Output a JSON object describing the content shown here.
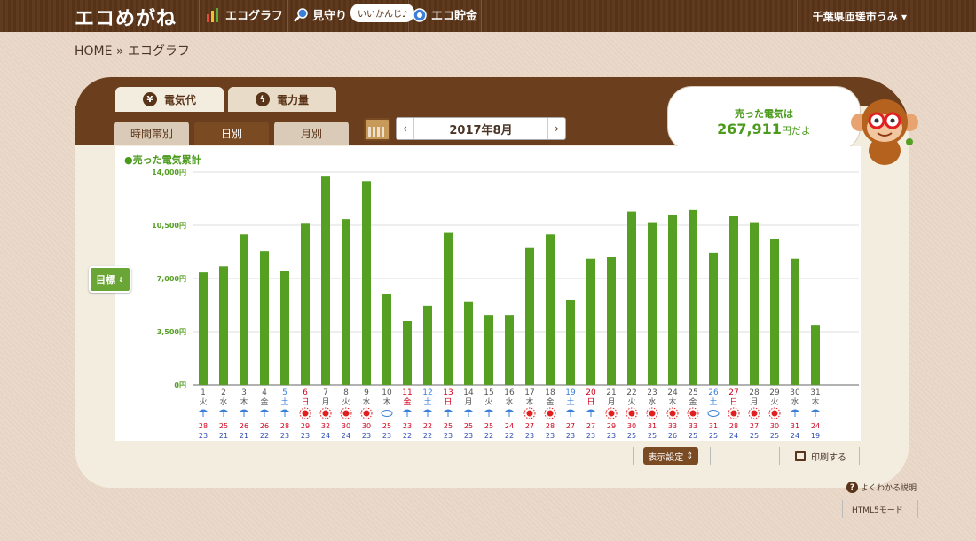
{
  "header": {
    "logo": "エコめがね",
    "nav": [
      {
        "label": "エコグラフ",
        "icon": "bar-chart-icon"
      },
      {
        "label": "見守り",
        "icon": "magnifier-icon"
      },
      {
        "label": "エコ貯金",
        "icon": "coin-icon"
      }
    ],
    "bubble": "いいかんじ♪",
    "user_location": "千葉県匝瑳市うみ",
    "user_dropdown_icon": "chevron-down-icon"
  },
  "breadcrumb": "HOME » エコグラフ",
  "tabs_primary": [
    {
      "label": "電気代",
      "icon": "yen-icon",
      "active": true
    },
    {
      "label": "電力量",
      "icon": "lightning-icon",
      "active": false
    }
  ],
  "tabs_secondary": [
    {
      "label": "時間帯別",
      "active": false
    },
    {
      "label": "日別",
      "active": true
    },
    {
      "label": "月別",
      "active": false
    }
  ],
  "month_selector": {
    "prev": "‹",
    "label": "2017年8月",
    "next": "›"
  },
  "balloon": {
    "line1": "売った電気は",
    "amount": "267,911",
    "suffix": "円だよ"
  },
  "chart_title": "●売った電気累計",
  "goal_button": "目標",
  "display_settings": "表示設定",
  "print_label": "印刷する",
  "help_label": "よくわかる説明",
  "html5_label": "HTML5モード",
  "colors": {
    "bar": "#55a023",
    "brown": "#5a3418",
    "sunday": "#d0021b",
    "saturday": "#3b7fd8",
    "high_temp": "#d0021b",
    "low_temp": "#2a4ab0"
  },
  "chart_data": {
    "type": "bar",
    "title": "売った電気累計",
    "yunit": "円",
    "ylim": [
      0,
      14000
    ],
    "yticks": [
      "0円",
      "3,500円",
      "7,000円",
      "10,500円",
      "14,000円"
    ],
    "days": [
      {
        "d": "1",
        "w": "火",
        "v": 7400,
        "wx": "rain",
        "hi": 28,
        "lo": 23,
        "c": "n"
      },
      {
        "d": "2",
        "w": "水",
        "v": 7800,
        "wx": "rain",
        "hi": 25,
        "lo": 21,
        "c": "n"
      },
      {
        "d": "3",
        "w": "木",
        "v": 9900,
        "wx": "rain",
        "hi": 26,
        "lo": 21,
        "c": "n"
      },
      {
        "d": "4",
        "w": "金",
        "v": 8800,
        "wx": "umbrella",
        "hi": 26,
        "lo": 22,
        "c": "n"
      },
      {
        "d": "5",
        "w": "土",
        "v": 7500,
        "wx": "rain",
        "hi": 28,
        "lo": 23,
        "c": "sat"
      },
      {
        "d": "6",
        "w": "日",
        "v": 10600,
        "wx": "sun",
        "hi": 29,
        "lo": 23,
        "c": "sun"
      },
      {
        "d": "7",
        "w": "月",
        "v": 13700,
        "wx": "sun",
        "hi": 32,
        "lo": 24,
        "c": "n"
      },
      {
        "d": "8",
        "w": "火",
        "v": 10900,
        "wx": "sun",
        "hi": 30,
        "lo": 24,
        "c": "n"
      },
      {
        "d": "9",
        "w": "水",
        "v": 13400,
        "wx": "sun",
        "hi": 30,
        "lo": 23,
        "c": "n"
      },
      {
        "d": "10",
        "w": "木",
        "v": 6000,
        "wx": "cloud",
        "hi": 25,
        "lo": 23,
        "c": "n"
      },
      {
        "d": "11",
        "w": "金",
        "v": 4200,
        "wx": "rain",
        "hi": 23,
        "lo": 22,
        "c": "sun"
      },
      {
        "d": "12",
        "w": "土",
        "v": 5200,
        "wx": "rain",
        "hi": 22,
        "lo": 22,
        "c": "sat"
      },
      {
        "d": "13",
        "w": "日",
        "v": 10000,
        "wx": "rain",
        "hi": 25,
        "lo": 23,
        "c": "sun"
      },
      {
        "d": "14",
        "w": "月",
        "v": 5500,
        "wx": "rain",
        "hi": 25,
        "lo": 23,
        "c": "n"
      },
      {
        "d": "15",
        "w": "火",
        "v": 4600,
        "wx": "rain",
        "hi": 25,
        "lo": 22,
        "c": "n"
      },
      {
        "d": "16",
        "w": "水",
        "v": 4600,
        "wx": "rain",
        "hi": 24,
        "lo": 22,
        "c": "n"
      },
      {
        "d": "17",
        "w": "木",
        "v": 9000,
        "wx": "sun",
        "hi": 27,
        "lo": 23,
        "c": "n"
      },
      {
        "d": "18",
        "w": "金",
        "v": 9900,
        "wx": "sun",
        "hi": 28,
        "lo": 23,
        "c": "n"
      },
      {
        "d": "19",
        "w": "土",
        "v": 5600,
        "wx": "rain",
        "hi": 27,
        "lo": 23,
        "c": "sat"
      },
      {
        "d": "20",
        "w": "日",
        "v": 8300,
        "wx": "rain",
        "hi": 27,
        "lo": 23,
        "c": "sun"
      },
      {
        "d": "21",
        "w": "月",
        "v": 8400,
        "wx": "sun",
        "hi": 29,
        "lo": 23,
        "c": "n"
      },
      {
        "d": "22",
        "w": "火",
        "v": 11400,
        "wx": "sun",
        "hi": 30,
        "lo": 25,
        "c": "n"
      },
      {
        "d": "23",
        "w": "水",
        "v": 10700,
        "wx": "sun",
        "hi": 31,
        "lo": 25,
        "c": "n"
      },
      {
        "d": "24",
        "w": "木",
        "v": 11200,
        "wx": "sun",
        "hi": 33,
        "lo": 26,
        "c": "n"
      },
      {
        "d": "25",
        "w": "金",
        "v": 11500,
        "wx": "sun",
        "hi": 33,
        "lo": 25,
        "c": "n"
      },
      {
        "d": "26",
        "w": "土",
        "v": 8700,
        "wx": "cloud",
        "hi": 31,
        "lo": 25,
        "c": "sat"
      },
      {
        "d": "27",
        "w": "日",
        "v": 11100,
        "wx": "sun",
        "hi": 28,
        "lo": 24,
        "c": "sun"
      },
      {
        "d": "28",
        "w": "月",
        "v": 10700,
        "wx": "sun",
        "hi": 27,
        "lo": 25,
        "c": "n"
      },
      {
        "d": "29",
        "w": "火",
        "v": 9600,
        "wx": "sun",
        "hi": 30,
        "lo": 25,
        "c": "n"
      },
      {
        "d": "30",
        "w": "水",
        "v": 8300,
        "wx": "rain",
        "hi": 31,
        "lo": 24,
        "c": "n"
      },
      {
        "d": "31",
        "w": "木",
        "v": 3900,
        "wx": "umbrella",
        "hi": 24,
        "lo": 19,
        "c": "n"
      }
    ]
  }
}
